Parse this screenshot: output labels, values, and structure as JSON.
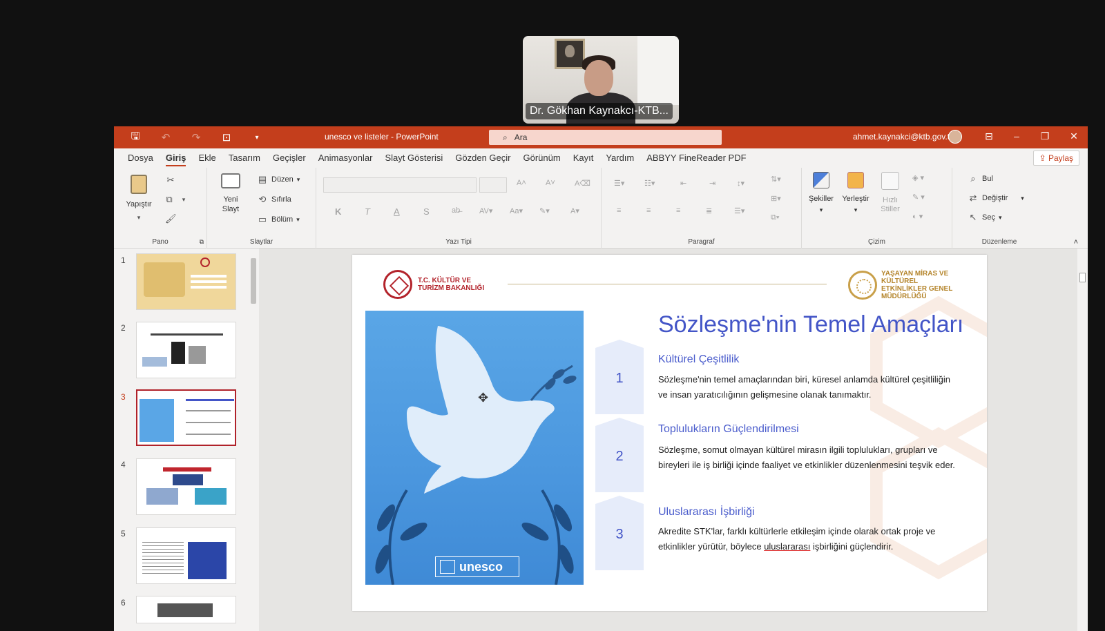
{
  "video": {
    "participant_name": "Dr. Gökhan Kaynakcı-KTB..."
  },
  "app": {
    "doc_title": "unesco ve listeler  -  PowerPoint",
    "search_placeholder": "Ara",
    "user_email": "ahmet.kaynakci@ktb.gov.tr",
    "accent": "#c43e1c"
  },
  "menu": {
    "tabs": [
      "Dosya",
      "Giriş",
      "Ekle",
      "Tasarım",
      "Geçişler",
      "Animasyonlar",
      "Slayt Gösterisi",
      "Gözden Geçir",
      "Görünüm",
      "Kayıt",
      "Yardım",
      "ABBYY FineReader PDF"
    ],
    "active": "Giriş",
    "share": "Paylaş"
  },
  "ribbon": {
    "pano": {
      "label": "Pano",
      "paste": "Yapıştır"
    },
    "slaytlar": {
      "label": "Slaytlar",
      "new_slide": "Yeni Slayt",
      "layout": "Düzen",
      "reset": "Sıfırla",
      "section": "Bölüm"
    },
    "yazi_tipi": {
      "label": "Yazı Tipi",
      "bold": "K",
      "italic": "T",
      "underline": "A",
      "shadow": "S"
    },
    "paragraf": {
      "label": "Paragraf"
    },
    "cizim": {
      "label": "Çizim",
      "shapes": "Şekiller",
      "arrange": "Yerleştir",
      "quick_styles": "Hızlı Stiller"
    },
    "duzenleme": {
      "label": "Düzenleme",
      "find": "Bul",
      "replace": "Değiştir",
      "select": "Seç"
    }
  },
  "thumbnails": [
    "1",
    "2",
    "3",
    "4",
    "5",
    "6"
  ],
  "selected_slide": "3",
  "slide": {
    "ministry_logo": "T.C. KÜLTÜR VE TURİZM BAKANLIĞI",
    "dept_logo": "YAŞAYAN MİRAS VE KÜLTÜREL ETKİNLİKLER GENEL MÜDÜRLÜĞÜ",
    "title": "Sözleşme'nin Temel Amaçları",
    "badge": "unesco",
    "items": [
      {
        "num": "1",
        "title": "Kültürel Çeşitlilik",
        "body": "Sözleşme'nin temel amaçlarından biri, küresel anlamda kültürel çeşitliliğin ve insan yaratıcılığının gelişmesine olanak tanımaktır."
      },
      {
        "num": "2",
        "title": "Toplulukların Güçlendirilmesi",
        "body": "Sözleşme, somut olmayan kültürel mirasın ilgili toplulukları, grupları ve bireyleri ile iş birliği içinde faaliyet ve etkinlikler düzenlenmesini teşvik eder."
      },
      {
        "num": "3",
        "title": "Uluslararası İşbirliği",
        "body_pre": "Akredite STK'lar, farklı kültürlerle etkileşim içinde olarak ortak proje ve etkinlikler yürütür, böylece ",
        "body_ul": "uluslararası",
        "body_post": " işbirliğini güçlendirir."
      }
    ]
  }
}
